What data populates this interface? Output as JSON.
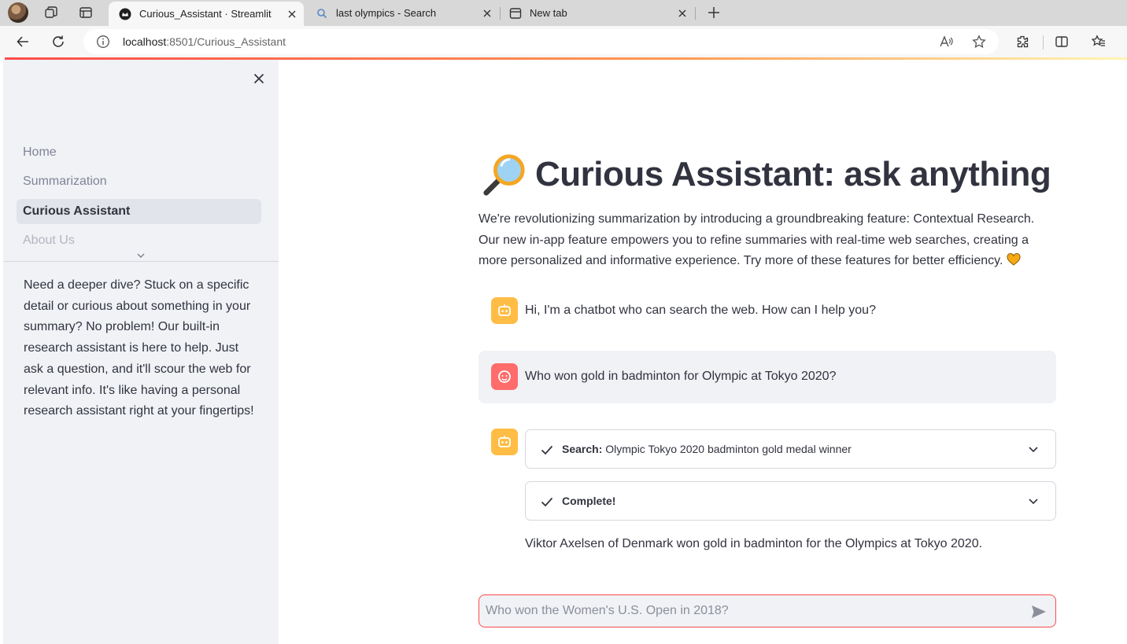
{
  "browser": {
    "tabs": [
      {
        "title": "Curious_Assistant · Streamlit",
        "active": true,
        "icon": "streamlit-crown-icon"
      },
      {
        "title": "last olympics - Search",
        "active": false,
        "icon": "search-icon"
      },
      {
        "title": "New tab",
        "active": false,
        "icon": "new-tab-icon"
      }
    ],
    "url_host": "localhost",
    "url_rest": ":8501/Curious_Assistant"
  },
  "sidebar": {
    "nav": [
      {
        "label": "Home",
        "active": false
      },
      {
        "label": "Summarization",
        "active": false
      },
      {
        "label": "Curious Assistant",
        "active": true
      },
      {
        "label": "About Us",
        "active": false
      }
    ],
    "description": "Need a deeper dive? Stuck on a specific detail or curious about something in your summary? No problem! Our built-in research assistant is here to help. Just ask a question, and it'll scour the web for relevant info. It's like having a personal research assistant right at your fingertips!"
  },
  "main": {
    "title": "Curious Assistant: ask anything",
    "intro": "We're revolutionizing summarization by introducing a groundbreaking feature: Contextual Research. Our new in-app feature empowers you to refine summaries with real-time web searches, creating a more personalized and informative experience. Try more of these features for better efficiency."
  },
  "chat": {
    "bot_greeting": "Hi, I'm a chatbot who can search the web. How can I help you?",
    "user_question": "Who won gold in badminton for Olympic at Tokyo 2020?",
    "search_step": {
      "label": "Search:",
      "query": "Olympic Tokyo 2020 badminton gold medal winner"
    },
    "complete_step": {
      "label": "Complete!"
    },
    "answer": "Viktor Axelsen of Denmark won gold in badminton for the Olympics at Tokyo 2020.",
    "input_placeholder": "Who won the Women's U.S. Open in 2018?"
  },
  "colors": {
    "accent": "#ff4b4b",
    "sidebar_bg": "#f0f2f6",
    "bot_avatar": "#ffbd45",
    "user_avatar": "#ff6c6c",
    "text": "#31333f"
  }
}
